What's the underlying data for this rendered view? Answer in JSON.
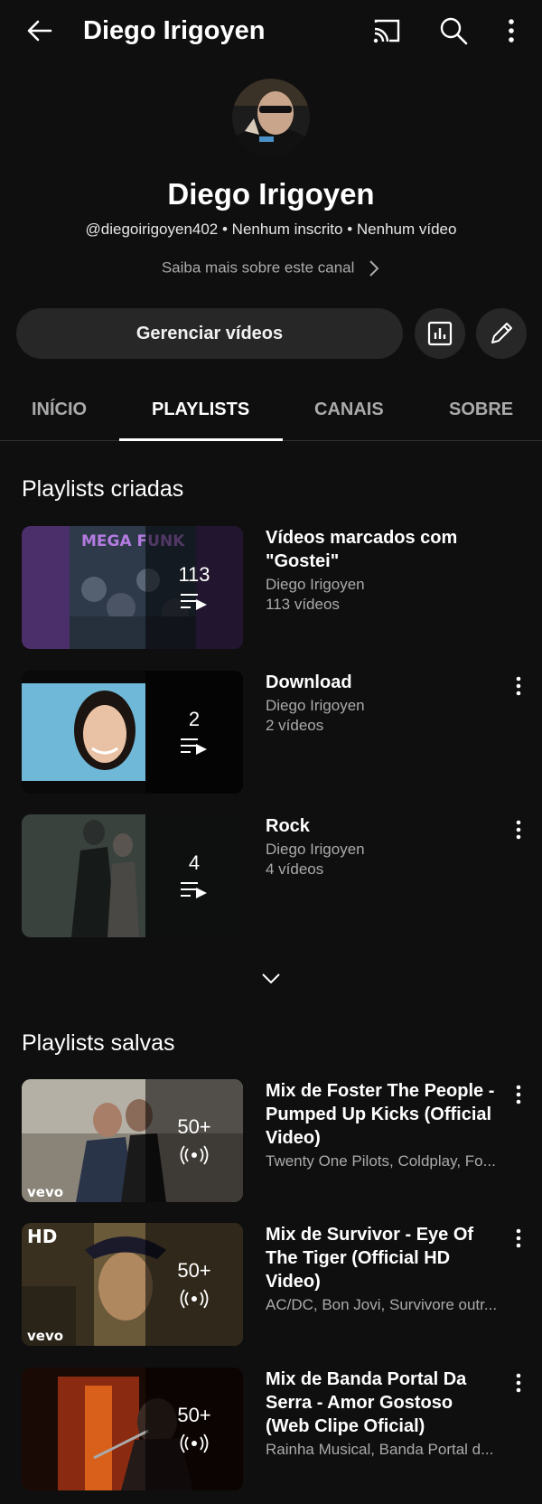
{
  "header": {
    "title": "Diego Irigoyen"
  },
  "channel": {
    "name": "Diego Irigoyen",
    "meta": "@diegoirigoyen402 • Nenhum inscrito • Nenhum vídeo",
    "about_link": "Saiba mais sobre este canal",
    "manage_button": "Gerenciar vídeos"
  },
  "tabs": [
    "INÍCIO",
    "PLAYLISTS",
    "CANAIS",
    "SOBRE"
  ],
  "created": {
    "section_title": "Playlists criadas",
    "items": [
      {
        "title": "Vídeos marcados com \"Gostei\"",
        "owner": "Diego Irigoyen",
        "videos": "113 vídeos",
        "count": "113",
        "thumb_text": "MEGA FUNK"
      },
      {
        "title": "Download",
        "owner": "Diego Irigoyen",
        "videos": "2 vídeos",
        "count": "2"
      },
      {
        "title": "Rock",
        "owner": "Diego Irigoyen",
        "videos": "4 vídeos",
        "count": "4"
      }
    ]
  },
  "saved": {
    "section_title": "Playlists salvas",
    "items": [
      {
        "title": "Mix de Foster The People - Pumped Up Kicks (Official Video)",
        "artists": "Twenty One Pilots, Coldplay, Fo...",
        "count": "50+",
        "badge": "vevo"
      },
      {
        "title": "Mix de Survivor - Eye Of The Tiger (Official HD Video)",
        "artists": "AC/DC, Bon Jovi, Survivore outr...",
        "count": "50+",
        "badge": "vevo",
        "hd": "HD"
      },
      {
        "title": "Mix de Banda Portal Da Serra  - Amor Gostoso (Web Clipe Oficial)",
        "artists": "Rainha Musical, Banda Portal d...",
        "count": "50+"
      }
    ]
  },
  "colors": {
    "background": "#0f0f0f",
    "button": "#272727",
    "secondary_text": "#aaaaaa"
  }
}
